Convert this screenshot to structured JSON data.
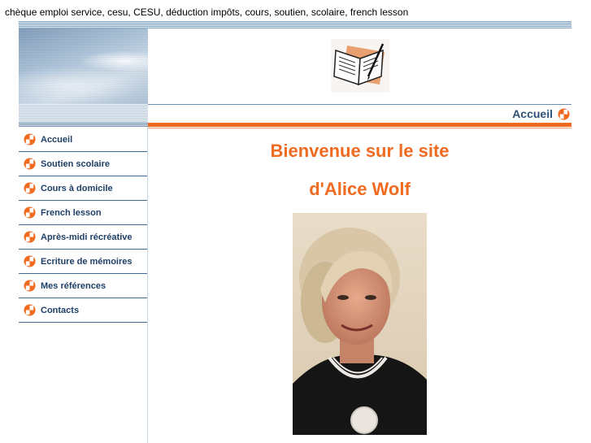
{
  "meta": {
    "keywords": "chèque emploi service, cesu, CESU, déduction impôts, cours, soutien, scolaire, french lesson"
  },
  "header": {
    "page_title": "Accueil"
  },
  "nav": {
    "items": [
      {
        "label": "Accueil"
      },
      {
        "label": "Soutien scolaire"
      },
      {
        "label": "Cours à domicile"
      },
      {
        "label": "French lesson"
      },
      {
        "label": "Après-midi récréative"
      },
      {
        "label": "Ecriture de mémoires"
      },
      {
        "label": "Mes références"
      },
      {
        "label": "Contacts"
      }
    ]
  },
  "main": {
    "welcome_line1": "Bienvenue sur le site",
    "welcome_line2": "d'Alice Wolf"
  },
  "colors": {
    "accent": "#f06a1f",
    "nav_text": "#1e3f66",
    "heading_text": "#2e5277"
  },
  "icons": {
    "nav_bullet": "orange-quadrant-bullet-icon",
    "logo": "open-book-logo-icon",
    "portrait": "portrait-photo"
  }
}
